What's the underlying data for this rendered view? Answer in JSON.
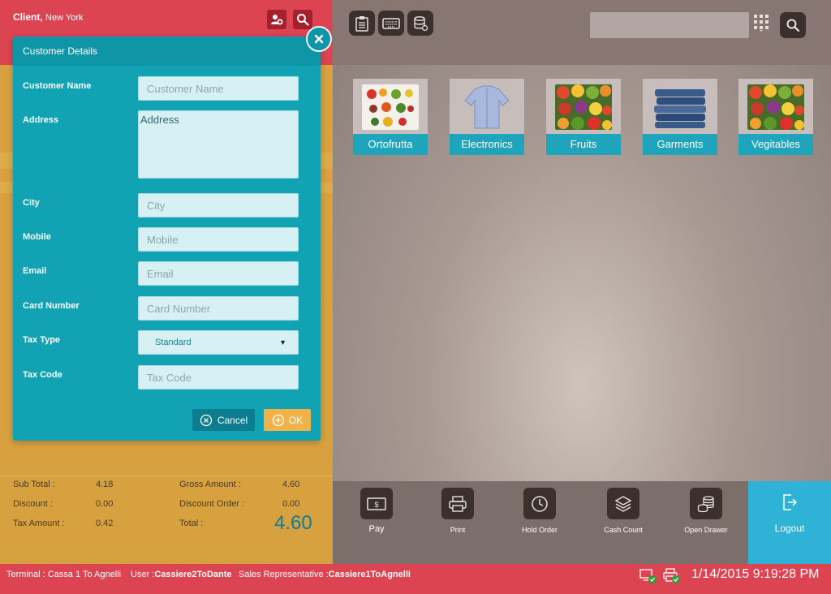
{
  "header": {
    "client_label": "Client,",
    "client_location": "New York"
  },
  "topbar": {
    "search_placeholder": ""
  },
  "categories": [
    {
      "label": "Ortofrutta"
    },
    {
      "label": "Electronics"
    },
    {
      "label": "Fruits"
    },
    {
      "label": "Garments"
    },
    {
      "label": "Vegitables"
    }
  ],
  "totals": {
    "sub_total_label": "Sub Total :",
    "sub_total": "4.18",
    "discount_label": "Discount :",
    "discount": "0.00",
    "tax_amount_label": "Tax Amount :",
    "tax_amount": "0.42",
    "gross_amount_label": "Gross Amount :",
    "gross_amount": "4.60",
    "discount_order_label": "Discount Order :",
    "discount_order": "0.00",
    "total_label": "Total :",
    "total": "4.60"
  },
  "actions": [
    {
      "label": "Pay"
    },
    {
      "label": "Print"
    },
    {
      "label": "Hold Order"
    },
    {
      "label": "Cash Count"
    },
    {
      "label": "Open Drawer"
    }
  ],
  "logout_label": "Logout",
  "modal": {
    "title": "Customer Details",
    "fields": {
      "customer_name": {
        "label": "Customer Name",
        "placeholder": "Customer Name",
        "value": ""
      },
      "address": {
        "label": "Address",
        "placeholder": "Address",
        "value": ""
      },
      "city": {
        "label": "City",
        "placeholder": "City",
        "value": ""
      },
      "mobile": {
        "label": "Mobile",
        "placeholder": "Mobile",
        "value": ""
      },
      "email": {
        "label": "Email",
        "placeholder": "Email",
        "value": ""
      },
      "card_number": {
        "label": "Card Number",
        "placeholder": "Card Number",
        "value": ""
      },
      "tax_type": {
        "label": "Tax Type",
        "selected": "Standard"
      },
      "tax_code": {
        "label": "Tax Code",
        "placeholder": "Tax Code",
        "value": ""
      }
    },
    "cancel_label": "Cancel",
    "ok_label": "OK"
  },
  "status": {
    "terminal_label": "Terminal : ",
    "terminal": "Cassa 1 To Agnelli",
    "user_label": "User :",
    "user": "Cassiere2ToDante",
    "sales_rep_label": "Sales Representative :",
    "sales_rep": "Cassiere1ToAgnelli",
    "datetime": "1/14/2015 9:19:28 PM"
  },
  "colors": {
    "header_red": "#dc4452",
    "panel_gold": "#d7a13f",
    "modal_teal": "#11a2b3",
    "category_label_teal": "#1ea5bb",
    "logout_blue": "#2eb2d6",
    "ok_orange": "#f2b24a"
  }
}
